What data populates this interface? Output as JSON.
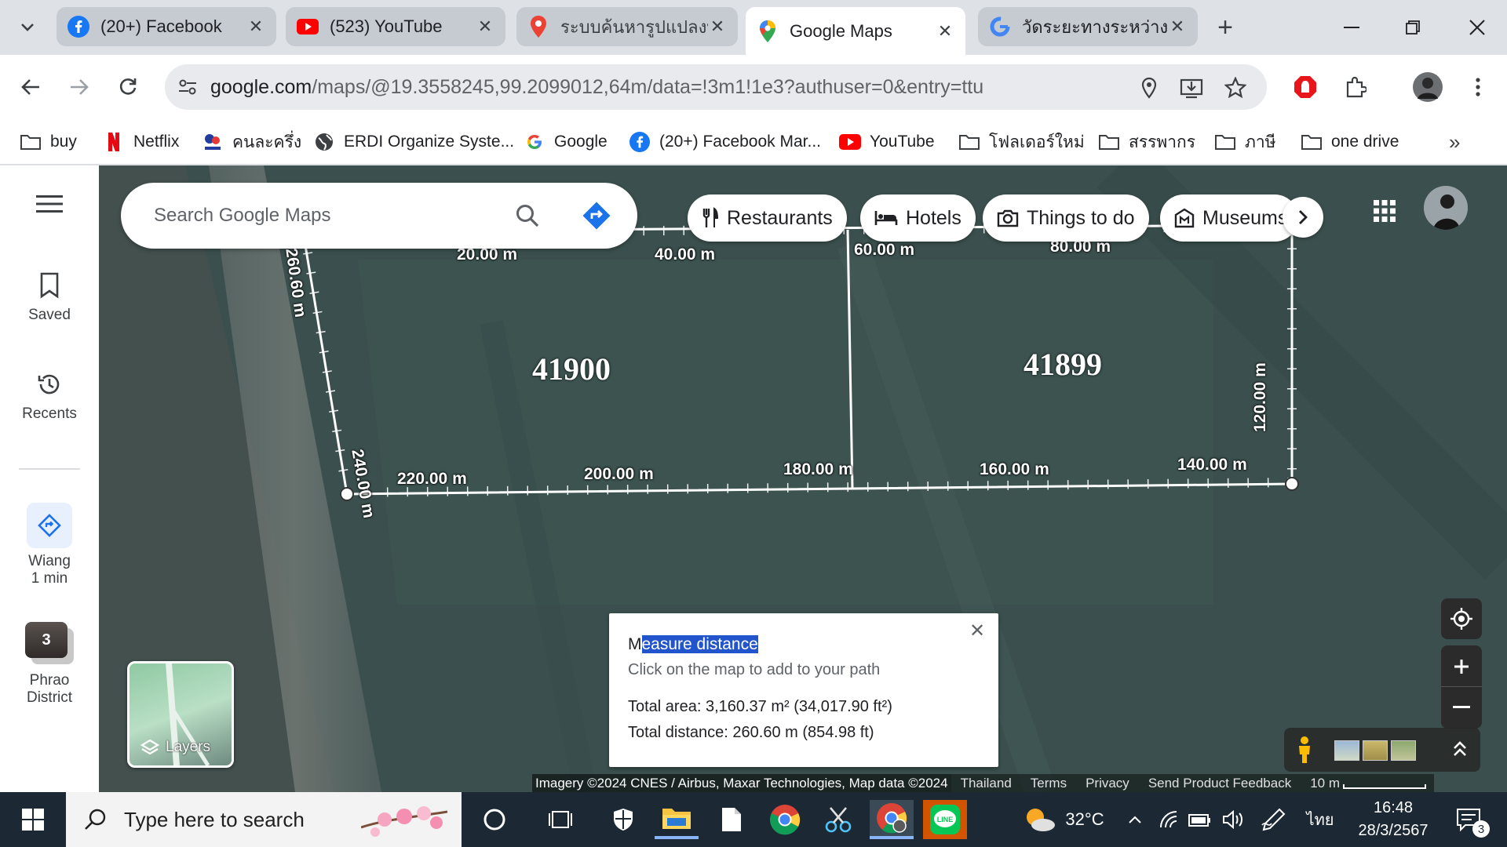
{
  "tabs": [
    {
      "title": "(20+) Facebook",
      "icon": "facebook-icon"
    },
    {
      "title": "(523) YouTube",
      "icon": "youtube-icon"
    },
    {
      "title": "ระบบค้นหารูปแปลงที่ดิน",
      "icon": "maps-pin-icon"
    },
    {
      "title": "Google Maps",
      "icon": "google-maps-icon"
    },
    {
      "title": "วัดระยะทางระหว่างจุด",
      "icon": "google-icon"
    }
  ],
  "toolbar": {
    "url_host": "google.com",
    "url_path": "/maps/@19.3558245,99.2099012,64m/data=!3m1!1e3?authuser=0&entry=ttu"
  },
  "bookmarks": [
    {
      "label": "buy",
      "icon": "folder-icon"
    },
    {
      "label": "Netflix",
      "icon": "netflix-icon"
    },
    {
      "label": "คนละครึ่ง",
      "icon": "khonlakhrueng-icon"
    },
    {
      "label": "ERDI Organize Syste...",
      "icon": "globe-icon"
    },
    {
      "label": "Google",
      "icon": "google-icon"
    },
    {
      "label": "(20+) Facebook Mar...",
      "icon": "facebook-icon"
    },
    {
      "label": "YouTube",
      "icon": "youtube-icon"
    },
    {
      "label": "โฟลเดอร์ใหม่",
      "icon": "folder-icon"
    },
    {
      "label": "สรรพากร",
      "icon": "folder-icon"
    },
    {
      "label": "ภาษี",
      "icon": "folder-icon"
    },
    {
      "label": "one drive",
      "icon": "folder-icon"
    }
  ],
  "rail": {
    "saved": "Saved",
    "recents": "Recents",
    "recent_place_1": {
      "line1": "Wiang",
      "line2": "1 min"
    },
    "recent_place_2": {
      "line1": "Phrao",
      "line2": "District",
      "badge": "3"
    }
  },
  "search": {
    "placeholder": "Search Google Maps"
  },
  "chips": [
    "Restaurants",
    "Hotels",
    "Things to do",
    "Museums"
  ],
  "map": {
    "parcels": [
      "41900",
      "41899"
    ],
    "segment_labels": [
      "260.60 m",
      "20.00 m",
      "40.00 m",
      "60.00 m",
      "80.00 m",
      "240.00 m",
      "120.00 m",
      "220.00 m",
      "200.00 m",
      "180.00 m",
      "160.00 m",
      "140.00 m"
    ],
    "layers_label": "Layers"
  },
  "measure": {
    "title_first": "M",
    "title_rest": "easure distance",
    "hint": "Click on the map to add to your path",
    "total_area": "Total area: 3,160.37 m² (34,017.90 ft²)",
    "total_distance": "Total distance: 260.60 m (854.98 ft)"
  },
  "attribution": {
    "imagery": "Imagery ©2024 CNES / Airbus, Maxar Technologies, Map data ©2024",
    "country": "Thailand",
    "terms": "Terms",
    "privacy": "Privacy",
    "feedback": "Send Product Feedback",
    "scale": "10 m"
  },
  "taskbar": {
    "search_placeholder": "Type here to search",
    "weather": "32°C",
    "language": "ไทย",
    "time": "16:48",
    "date": "28/3/2567",
    "notifications": "3"
  },
  "colors": {
    "map_imagery": "#3a4f4d",
    "measure_line": "#ffffff",
    "taskbar": "#1c2833",
    "selection": "#2255cc"
  }
}
